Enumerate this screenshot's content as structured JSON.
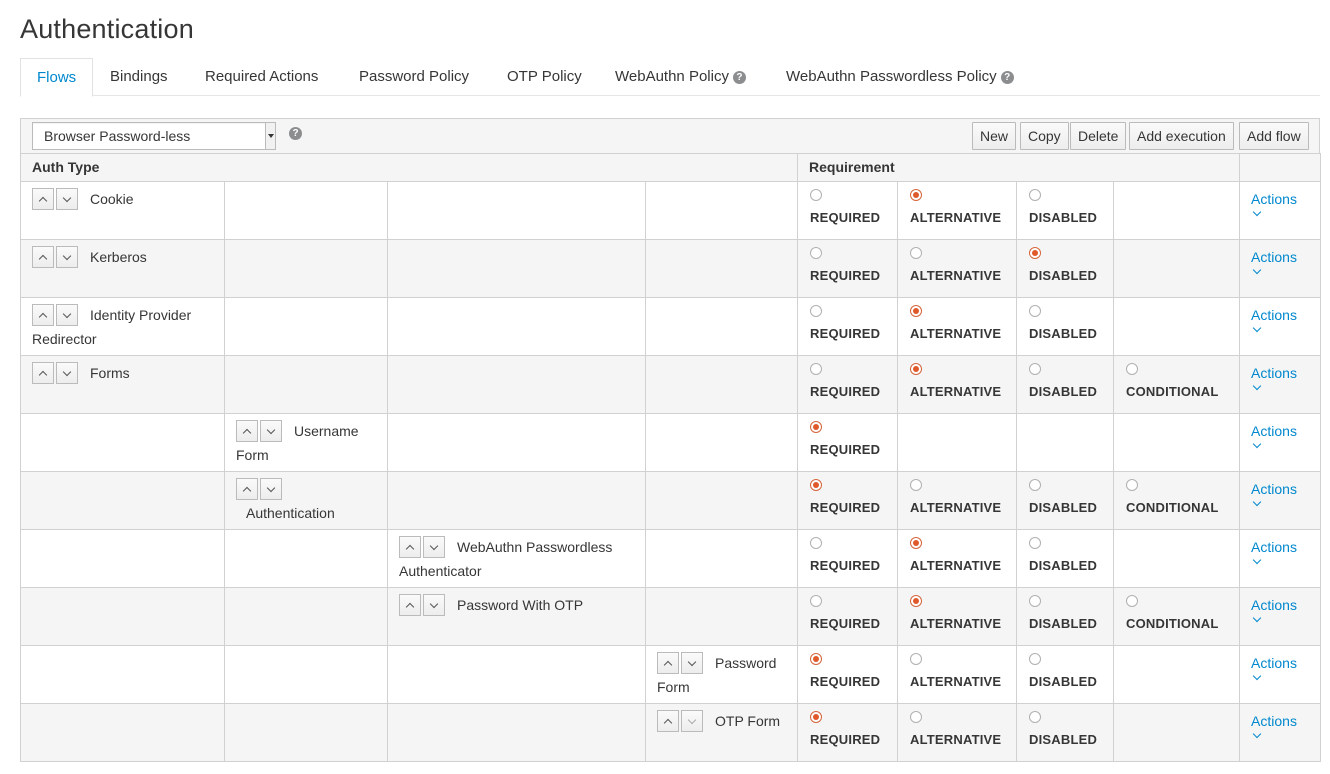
{
  "page": {
    "title": "Authentication"
  },
  "tabs": [
    {
      "label": "Flows",
      "active": true
    },
    {
      "label": "Bindings"
    },
    {
      "label": "Required Actions"
    },
    {
      "label": "Password Policy"
    },
    {
      "label": "OTP Policy"
    },
    {
      "label": "WebAuthn Policy",
      "help": true
    },
    {
      "label": "WebAuthn Passwordless Policy",
      "help": true
    }
  ],
  "toolbar": {
    "selected_flow": "Browser Password-less",
    "help_icon": "question-circle-icon",
    "buttons": [
      "New",
      "Copy",
      "Delete",
      "Add execution",
      "Add flow"
    ]
  },
  "table": {
    "headers": {
      "auth_type": "Auth Type",
      "requirement": "Requirement"
    },
    "actions_label": "Actions",
    "requirement_labels": [
      "REQUIRED",
      "ALTERNATIVE",
      "DISABLED",
      "CONDITIONAL"
    ],
    "rows": [
      {
        "name": "Cookie",
        "level": 0,
        "options": [
          "REQUIRED",
          "ALTERNATIVE",
          "DISABLED"
        ],
        "selected": "ALTERNATIVE"
      },
      {
        "name": "Kerberos",
        "level": 0,
        "options": [
          "REQUIRED",
          "ALTERNATIVE",
          "DISABLED"
        ],
        "selected": "DISABLED"
      },
      {
        "name": "Identity Provider Redirector",
        "level": 0,
        "options": [
          "REQUIRED",
          "ALTERNATIVE",
          "DISABLED"
        ],
        "selected": "ALTERNATIVE"
      },
      {
        "name": "Forms",
        "level": 0,
        "options": [
          "REQUIRED",
          "ALTERNATIVE",
          "DISABLED",
          "CONDITIONAL"
        ],
        "selected": "ALTERNATIVE"
      },
      {
        "name": "Username Form",
        "level": 1,
        "options": [
          "REQUIRED"
        ],
        "selected": "REQUIRED"
      },
      {
        "name": "Authentication",
        "level": 1,
        "options": [
          "REQUIRED",
          "ALTERNATIVE",
          "DISABLED",
          "CONDITIONAL"
        ],
        "selected": "REQUIRED"
      },
      {
        "name": "WebAuthn Passwordless Authenticator",
        "level": 2,
        "options": [
          "REQUIRED",
          "ALTERNATIVE",
          "DISABLED"
        ],
        "selected": "ALTERNATIVE"
      },
      {
        "name": "Password With OTP",
        "level": 2,
        "options": [
          "REQUIRED",
          "ALTERNATIVE",
          "DISABLED",
          "CONDITIONAL"
        ],
        "selected": "ALTERNATIVE"
      },
      {
        "name": "Password Form",
        "level": 3,
        "options": [
          "REQUIRED",
          "ALTERNATIVE",
          "DISABLED"
        ],
        "selected": "REQUIRED"
      },
      {
        "name": "OTP Form",
        "level": 3,
        "options": [
          "REQUIRED",
          "ALTERNATIVE",
          "DISABLED"
        ],
        "selected": "REQUIRED"
      }
    ]
  },
  "colors": {
    "accent": "#0088ce",
    "radio_checked": "#e0592a",
    "border": "#d1d1d1",
    "stripe": "#f5f5f5"
  }
}
